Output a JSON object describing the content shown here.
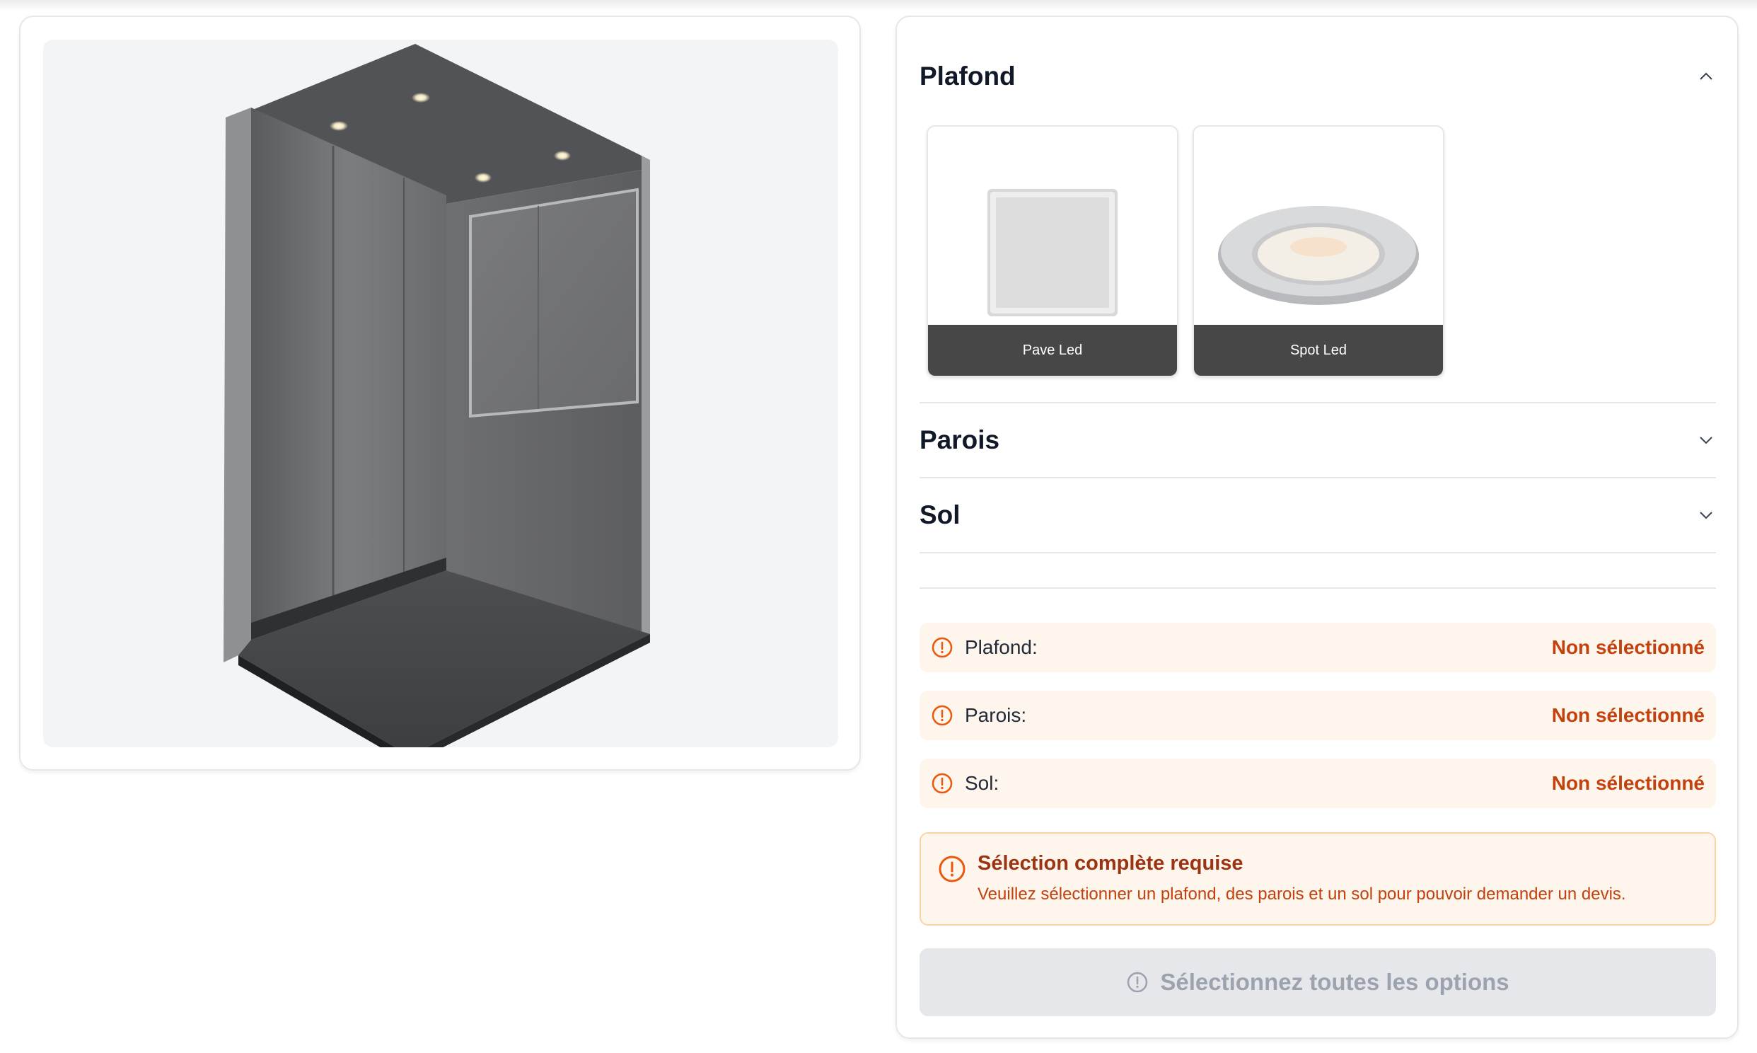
{
  "preview": {
    "alt": "elevator-cabin-preview"
  },
  "sections": {
    "plafond": {
      "title": "Plafond",
      "expanded": true
    },
    "parois": {
      "title": "Parois",
      "expanded": false
    },
    "sol": {
      "title": "Sol",
      "expanded": false
    }
  },
  "ceiling_options": [
    {
      "label": "Pave Led",
      "icon": "square-led-panel"
    },
    {
      "label": "Spot Led",
      "icon": "round-led-spot"
    }
  ],
  "summary": [
    {
      "label": "Plafond:",
      "value": "Non sélectionné"
    },
    {
      "label": "Parois:",
      "value": "Non sélectionné"
    },
    {
      "label": "Sol:",
      "value": "Non sélectionné"
    }
  ],
  "alert": {
    "title": "Sélection complète requise",
    "text": "Veuillez sélectionner un plafond, des parois et un sol pour pouvoir demander un devis."
  },
  "cta": {
    "label": "Sélectionnez toutes les options"
  },
  "colors": {
    "warning": "#c2410c",
    "warning_bg": "#fef5ec",
    "label_bg": "#474747"
  }
}
